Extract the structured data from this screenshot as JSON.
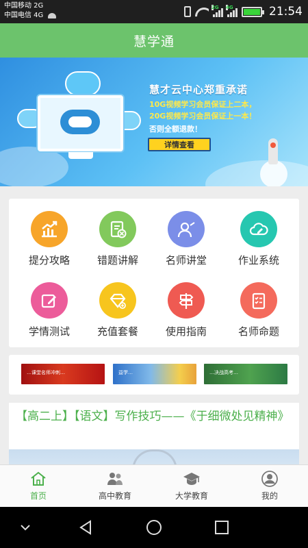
{
  "status_bar": {
    "carrier1": "中国移动 2G",
    "carrier2": "中国电信 4G",
    "time": "21:54",
    "signal_tag_1": "2G",
    "signal_tag_2": "4G",
    "icons": [
      "android-icon",
      "vibrate-icon",
      "wifi-icon",
      "signal-icon",
      "signal-icon",
      "battery-icon"
    ]
  },
  "app": {
    "title": "慧学通",
    "accent_color": "#6cc36c",
    "text_green": "#4cb04c"
  },
  "banner": {
    "headline": "慧才云中心郑重承诺",
    "line1": "10G视频学习会员保证上二本，",
    "line2": "20G视频学习会员保证上一本！",
    "line3": "否则全额退款！",
    "button_label": "详情查看",
    "slide_count": 4,
    "active_slide": 2
  },
  "features": [
    {
      "label": "提分攻略",
      "icon": "chart-up-icon",
      "color": "#f7a52a"
    },
    {
      "label": "错题讲解",
      "icon": "document-x-icon",
      "color": "#82c95c"
    },
    {
      "label": "名师讲堂",
      "icon": "teacher-icon",
      "color": "#7b8ee8"
    },
    {
      "label": "作业系统",
      "icon": "cloud-edit-icon",
      "color": "#26c7b0"
    },
    {
      "label": "学情测试",
      "icon": "pencil-square-icon",
      "color": "#ec5c9a"
    },
    {
      "label": "充值套餐",
      "icon": "diamond-plus-icon",
      "color": "#f7c51e"
    },
    {
      "label": "使用指南",
      "icon": "signpost-icon",
      "color": "#ef5a52"
    },
    {
      "label": "名师命题",
      "icon": "checklist-icon",
      "color": "#f46a5c"
    }
  ],
  "thumbnails": [
    {
      "caption": "…课堂名师冲刺…"
    },
    {
      "caption": "益学…"
    },
    {
      "caption": "…决战高考…"
    }
  ],
  "article": {
    "title": "【高二上】【语文】写作技巧——《于细微处见精神》"
  },
  "tabs": [
    {
      "label": "首页",
      "icon": "home-icon",
      "active": true
    },
    {
      "label": "高中教育",
      "icon": "people-icon",
      "active": false
    },
    {
      "label": "大学教育",
      "icon": "graduation-cap-icon",
      "active": false
    },
    {
      "label": "我的",
      "icon": "user-icon",
      "active": false
    }
  ],
  "nav": [
    "back-icon",
    "home-circle-icon",
    "recents-icon",
    "chevron-down-icon"
  ]
}
